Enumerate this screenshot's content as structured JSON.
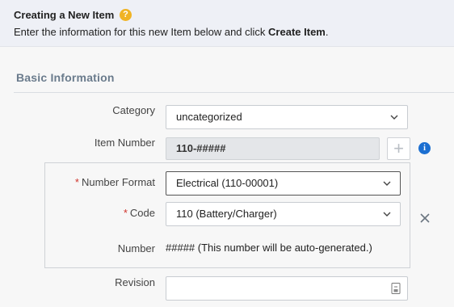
{
  "banner": {
    "title": "Creating a New Item",
    "help_icon": "question-circle-icon",
    "desc_prefix": "Enter the information for this new Item below and click ",
    "desc_bold": "Create Item",
    "desc_suffix": "."
  },
  "section": {
    "title": "Basic Information"
  },
  "form": {
    "category": {
      "label": "Category",
      "value": "uncategorized"
    },
    "item_number": {
      "label": "Item Number",
      "value": "110-#####",
      "add_icon": "plus-icon",
      "info_icon": "info-icon"
    },
    "number_format": {
      "required_mark": "*",
      "label": "Number Format",
      "value": "Electrical (110-00001)"
    },
    "code": {
      "required_mark": "*",
      "label": "Code",
      "value": "110 (Battery/Charger)"
    },
    "number": {
      "label": "Number",
      "value": "##### (This number will be auto-generated.)"
    },
    "revision": {
      "label": "Revision",
      "value": "",
      "icon": "document-icon"
    },
    "remove_icon": "close-icon"
  },
  "colors": {
    "required": "#d0342c",
    "info": "#1c6fd1",
    "help": "#f0b324"
  }
}
